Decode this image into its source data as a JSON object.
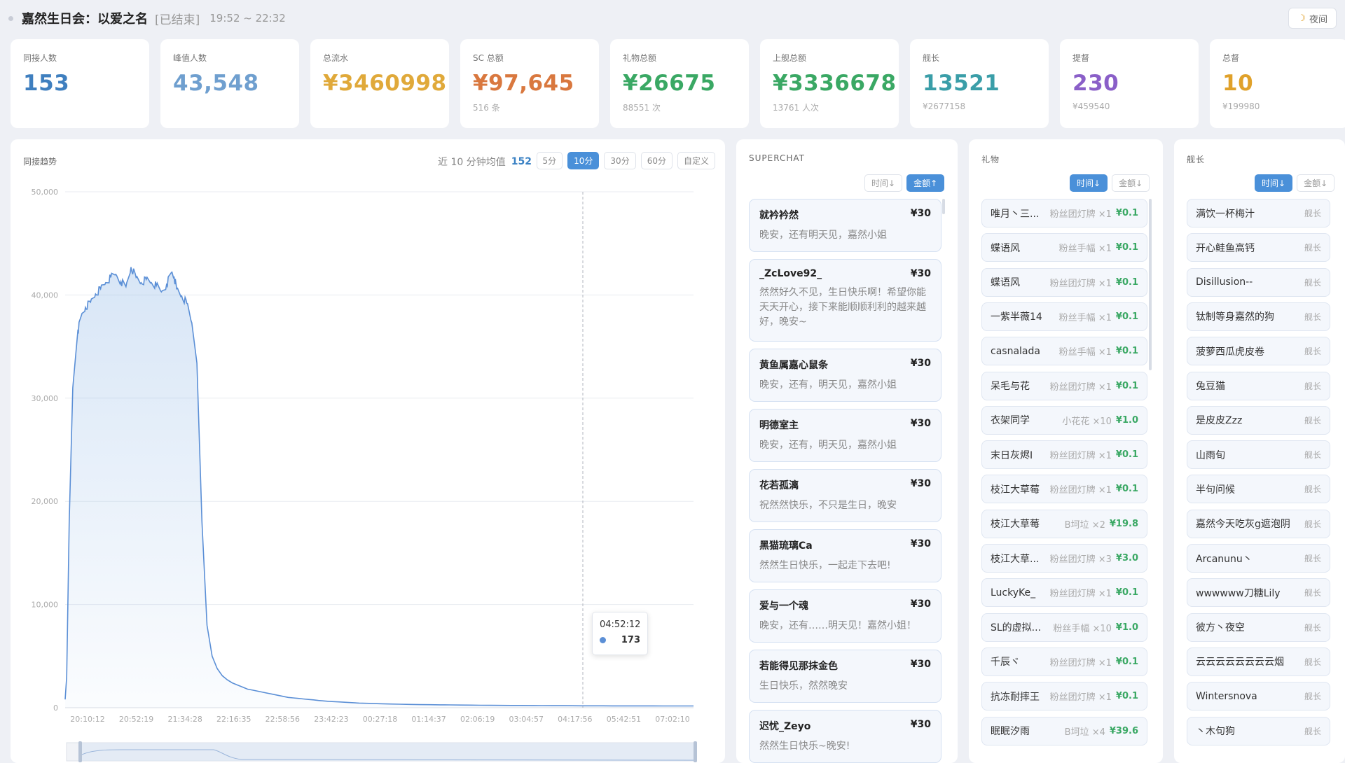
{
  "header": {
    "title": "嘉然生日会：以爱之名",
    "status": "[已结束]",
    "time_range": "19:52 ~ 22:32",
    "night_label": "夜间"
  },
  "stats": [
    {
      "label": "同接人数",
      "value": "153",
      "sub": "",
      "color": "#3f7fbf"
    },
    {
      "label": "峰值人数",
      "value": "43,548",
      "sub": "",
      "color": "#6f9fcf"
    },
    {
      "label": "总流水",
      "value": "¥3460998",
      "sub": "",
      "color": "#e0a93a"
    },
    {
      "label": "SC 总额",
      "value": "¥97,645",
      "sub": "516 条",
      "color": "#d9783f"
    },
    {
      "label": "礼物总额",
      "value": "¥26675",
      "sub": "88551 次",
      "color": "#3aa864"
    },
    {
      "label": "上舰总额",
      "value": "¥3336678",
      "sub": "13761 人次",
      "color": "#3aa864"
    },
    {
      "label": "舰长",
      "value": "13521",
      "sub": "¥2677158",
      "color": "#3a9ea8"
    },
    {
      "label": "提督",
      "value": "230",
      "sub": "¥459540",
      "color": "#8a5fc8"
    },
    {
      "label": "总督",
      "value": "10",
      "sub": "¥199980",
      "color": "#e0a12a"
    }
  ],
  "trend": {
    "title": "同接趋势",
    "avg_label": "近 10 分钟均值",
    "avg_value": "152",
    "ranges": [
      "5分",
      "10分",
      "30分",
      "60分",
      "自定义"
    ],
    "active_range": "10分",
    "tooltip": {
      "time": "04:52:12",
      "value": "173"
    }
  },
  "chart_data": {
    "type": "area",
    "title": "",
    "xlabel": "",
    "ylabel": "",
    "ylim": [
      0,
      50000
    ],
    "yticks": [
      "0",
      "10,000",
      "20,000",
      "30,000",
      "40,000",
      "50,000"
    ],
    "xticks": [
      "20:10:12",
      "20:52:19",
      "21:34:28",
      "22:16:35",
      "22:58:56",
      "23:42:23",
      "00:27:18",
      "01:14:37",
      "02:06:19",
      "03:04:57",
      "04:17:56",
      "05:42:51",
      "07:02:10"
    ],
    "x_index": [
      0,
      0.3,
      0.8,
      1.5,
      2.5,
      3.2,
      4,
      5,
      6,
      7,
      8,
      9,
      10,
      11,
      12,
      13,
      14,
      15,
      16,
      17,
      18,
      19,
      20,
      21,
      21.5,
      22,
      23,
      24,
      25,
      26,
      27,
      28,
      29,
      30,
      31,
      32,
      33,
      34,
      35,
      36,
      37,
      38,
      39,
      40,
      41,
      42,
      43,
      44,
      45,
      46,
      47,
      48,
      49,
      50,
      52,
      54,
      56,
      58,
      60,
      62,
      64,
      66,
      68,
      70,
      72,
      74,
      76,
      78,
      80,
      82,
      84,
      86,
      88,
      90,
      92,
      94,
      96,
      98,
      100,
      102,
      104,
      106,
      108,
      110,
      112,
      114,
      116,
      118,
      120,
      122,
      124
    ],
    "values": [
      800,
      3000,
      18000,
      31000,
      36500,
      38000,
      38800,
      39300,
      40100,
      40600,
      41200,
      41700,
      42000,
      41300,
      40800,
      42700,
      41700,
      41200,
      41500,
      41200,
      40900,
      40300,
      41000,
      42200,
      41800,
      40600,
      39900,
      39200,
      37300,
      33400,
      18000,
      8000,
      5000,
      3800,
      3100,
      2700,
      2400,
      2200,
      2000,
      1800,
      1700,
      1600,
      1500,
      1400,
      1300,
      1200,
      1100,
      1000,
      950,
      900,
      850,
      800,
      760,
      700,
      620,
      560,
      500,
      450,
      420,
      390,
      360,
      340,
      320,
      300,
      290,
      280,
      270,
      260,
      250,
      240,
      230,
      225,
      220,
      215,
      210,
      205,
      200,
      195,
      190,
      185,
      182,
      180,
      178,
      176,
      175,
      174,
      173,
      172,
      171,
      170,
      168
    ]
  },
  "superchat": {
    "title": "SUPERCHAT",
    "sort": [
      "时间↓",
      "金额↑"
    ],
    "active_sort": "金额↑",
    "items": [
      {
        "user": "就衿衿然",
        "amount": "¥30",
        "msg": "晚安，还有明天见，嘉然小姐"
      },
      {
        "user": "_ZcLove92_",
        "amount": "¥30",
        "msg": "然然好久不见，生日快乐啊！希望你能天天开心，接下来能顺顺利利的越来越好，晚安~"
      },
      {
        "user": "黄鱼属嘉心鼠条",
        "amount": "¥30",
        "msg": "晚安，还有，明天见，嘉然小姐"
      },
      {
        "user": "明德室主",
        "amount": "¥30",
        "msg": "晚安，还有，明天见，嘉然小姐"
      },
      {
        "user": "花若孤漓",
        "amount": "¥30",
        "msg": "祝然然快乐，不只是生日，晚安"
      },
      {
        "user": "黑猫琉璃Ca",
        "amount": "¥30",
        "msg": "然然生日快乐，一起走下去吧!"
      },
      {
        "user": "爱与一个魂",
        "amount": "¥30",
        "msg": "晚安，还有……明天见！嘉然小姐！"
      },
      {
        "user": "若能得见那抹金色",
        "amount": "¥30",
        "msg": "生日快乐，然然晚安"
      },
      {
        "user": "迟忧_Zeyo",
        "amount": "¥30",
        "msg": "然然生日快乐~晚安!"
      }
    ]
  },
  "gifts": {
    "title": "礼物",
    "sort": [
      "时间↓",
      "金额↓"
    ],
    "active_sort": "时间↓",
    "items": [
      {
        "user": "唯月丶三...",
        "item": "粉丝团灯牌 ×1",
        "value": "¥0.1"
      },
      {
        "user": "蝶语风",
        "item": "粉丝手幅 ×1",
        "value": "¥0.1"
      },
      {
        "user": "蝶语风",
        "item": "粉丝团灯牌 ×1",
        "value": "¥0.1"
      },
      {
        "user": "一紫半薇14",
        "item": "粉丝手幅 ×1",
        "value": "¥0.1"
      },
      {
        "user": "casnalada",
        "item": "粉丝手幅 ×1",
        "value": "¥0.1"
      },
      {
        "user": "呆毛与花",
        "item": "粉丝团灯牌 ×1",
        "value": "¥0.1"
      },
      {
        "user": "衣架同学",
        "item": "小花花 ×10",
        "value": "¥1.0"
      },
      {
        "user": "末日灰烬I",
        "item": "粉丝团灯牌 ×1",
        "value": "¥0.1"
      },
      {
        "user": "枝江大草莓",
        "item": "粉丝团灯牌 ×1",
        "value": "¥0.1"
      },
      {
        "user": "枝江大草莓",
        "item": "B坷垃 ×2",
        "value": "¥19.8"
      },
      {
        "user": "枝江大草...",
        "item": "粉丝团灯牌 ×3",
        "value": "¥3.0"
      },
      {
        "user": "LuckyKe_",
        "item": "粉丝团灯牌 ×1",
        "value": "¥0.1"
      },
      {
        "user": "SL的虚拟...",
        "item": "粉丝手幅 ×10",
        "value": "¥1.0"
      },
      {
        "user": "千辰ヾ",
        "item": "粉丝团灯牌 ×1",
        "value": "¥0.1"
      },
      {
        "user": "抗冻耐摔王",
        "item": "粉丝团灯牌 ×1",
        "value": "¥0.1"
      },
      {
        "user": "眠眠汐雨",
        "item": "B坷垃 ×4",
        "value": "¥39.6"
      }
    ]
  },
  "guards": {
    "title": "舰长",
    "sort": [
      "时间↓",
      "金额↓"
    ],
    "active_sort": "时间↓",
    "tag": "舰长",
    "items": [
      "满饮一杯梅汁",
      "开心鲑鱼高钙",
      "Disillusion--",
      "钛制等身嘉然的狗",
      "菠萝西瓜虎皮卷",
      "兔豆猫",
      "是皮皮Zzz",
      "山雨旬",
      "半句问候",
      "嘉然今天吃灰g遮泡阴",
      "Arcanunu丶",
      "wwwwww刀糖Lily",
      "彼方丶夜空",
      "云云云云云云云云烟",
      "Wintersnova",
      "丶木句狗"
    ]
  }
}
